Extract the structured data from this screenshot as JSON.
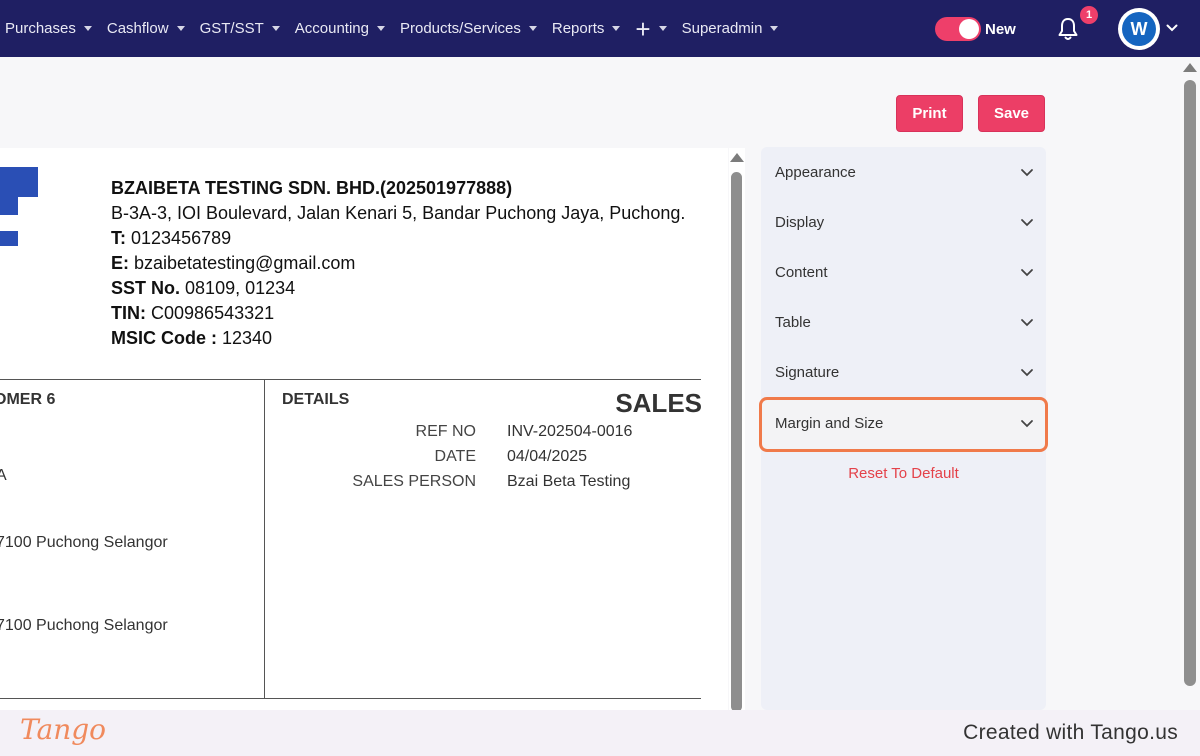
{
  "nav": {
    "items": [
      "Purchases",
      "Cashflow",
      "GST/SST",
      "Accounting",
      "Products/Services",
      "Reports",
      "+",
      "Superadmin"
    ],
    "toggle_label": "New",
    "notification_count": "1",
    "avatar_initial": "W"
  },
  "toolbar": {
    "print_label": "Print",
    "save_label": "Save"
  },
  "company": {
    "name": "BZAIBETA TESTING SDN. BHD.(202501977888)",
    "address": "B-3A-3, IOI Boulevard, Jalan Kenari 5, Bandar Puchong Jaya, Puchong.",
    "phone_label": "T:",
    "phone": "0123456789",
    "email_label": "E:",
    "email": "bzaibetatesting@gmail.com",
    "sst_label": "SST No.",
    "sst": "08109, 01234",
    "tin_label": "TIN:",
    "tin": "C00986543321",
    "msic_label": "MSIC Code :",
    "msic": "12340"
  },
  "customer": {
    "label": "OMER 6",
    "line1": "A",
    "line2": "7100 Puchong Selangor",
    "line3": "7100 Puchong Selangor"
  },
  "details": {
    "label": "DETAILS",
    "doc_title": "SALES",
    "rows": [
      {
        "key": "REF NO",
        "value": "INV-202504-0016"
      },
      {
        "key": "DATE",
        "value": "04/04/2025"
      },
      {
        "key": "SALES PERSON",
        "value": "Bzai Beta Testing"
      }
    ]
  },
  "panel": {
    "sections": [
      "Appearance",
      "Display",
      "Content",
      "Table",
      "Signature",
      "Margin and Size"
    ],
    "reset_label": "Reset To Default"
  },
  "footer": {
    "logo_text": "Tango",
    "credit": "Created with Tango.us"
  }
}
